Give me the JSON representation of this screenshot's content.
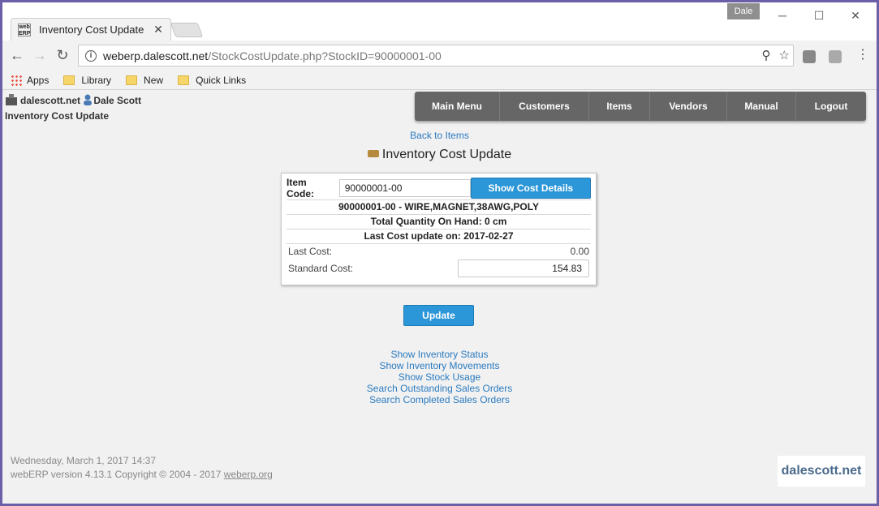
{
  "browser": {
    "tab_title": "Inventory Cost Update",
    "tab_favicon_text": "web ERP",
    "profile_name": "Dale",
    "url_host": "weberp.dalescott.net",
    "url_path": "/StockCostUpdate.php?StockID=90000001-00",
    "bookmarks": [
      "Apps",
      "Library",
      "New",
      "Quick Links"
    ]
  },
  "header": {
    "site": "dalescott.net",
    "user": "Dale Scott",
    "page_name": "Inventory Cost Update"
  },
  "nav": [
    "Main Menu",
    "Customers",
    "Items",
    "Vendors",
    "Manual",
    "Logout"
  ],
  "back_link": "Back to Items",
  "page_title": "Inventory Cost Update",
  "form": {
    "item_code_label": "Item Code:",
    "item_code_value": "90000001-00",
    "show_cost_button": "Show Cost Details",
    "description": "90000001-00 - WIRE,MAGNET,38AWG,POLY",
    "qoh": "Total Quantity On Hand: 0 cm",
    "last_update": "Last Cost update on: 2017-02-27",
    "last_cost_label": "Last Cost:",
    "last_cost_value": "0.00",
    "standard_cost_label": "Standard Cost:",
    "standard_cost_value": "154.83",
    "update_button": "Update"
  },
  "links": [
    "Show Inventory Status",
    "Show Inventory Movements",
    "Show Stock Usage",
    "Search Outstanding Sales Orders",
    "Search Completed Sales Orders"
  ],
  "footer": {
    "datetime": "Wednesday, March 1, 2017 14:37",
    "version": "webERP version 4.13.1 Copyright © 2004 - 2017 ",
    "version_link": "weberp.org",
    "logo": "dalescott.net"
  }
}
